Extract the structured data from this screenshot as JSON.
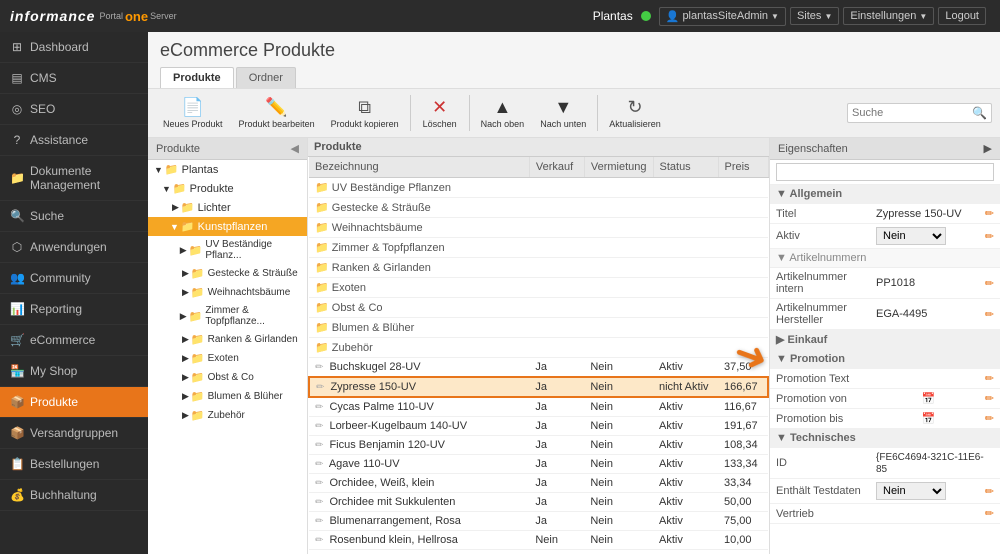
{
  "topbar": {
    "logo": "informance",
    "portal": "Portal",
    "one": "one",
    "server": "Server",
    "site": "Plantas",
    "user": "plantasSiteAdmin",
    "sites_label": "Sites",
    "settings_label": "Einstellungen",
    "logout_label": "Logout"
  },
  "sidebar": {
    "items": [
      {
        "id": "dashboard",
        "label": "Dashboard",
        "icon": "⊞"
      },
      {
        "id": "cms",
        "label": "CMS",
        "icon": "▤"
      },
      {
        "id": "seo",
        "label": "SEO",
        "icon": "◎"
      },
      {
        "id": "assistance",
        "label": "Assistance",
        "icon": "?"
      },
      {
        "id": "dokumente",
        "label": "Dokumente Management",
        "icon": "📁"
      },
      {
        "id": "suche",
        "label": "Suche",
        "icon": "🔍"
      },
      {
        "id": "anwendungen",
        "label": "Anwendungen",
        "icon": "⬡"
      },
      {
        "id": "community",
        "label": "Community",
        "icon": "👥"
      },
      {
        "id": "reporting",
        "label": "Reporting",
        "icon": "📊"
      },
      {
        "id": "ecommerce",
        "label": "eCommerce",
        "icon": "🛒"
      },
      {
        "id": "myshop",
        "label": "My Shop",
        "icon": "🏪"
      },
      {
        "id": "produkte",
        "label": "Produkte",
        "icon": "📦",
        "active": true
      },
      {
        "id": "versandgruppen",
        "label": "Versandgruppen",
        "icon": "📦"
      },
      {
        "id": "bestellungen",
        "label": "Bestellungen",
        "icon": "📋"
      },
      {
        "id": "buchhaltung",
        "label": "Buchhaltung",
        "icon": "💰"
      }
    ]
  },
  "content": {
    "title": "eCommerce Produkte",
    "tabs": [
      "Produkte",
      "Ordner"
    ],
    "active_tab": "Produkte"
  },
  "toolbar": {
    "buttons": [
      {
        "id": "new",
        "label": "Neues Produkt",
        "icon": "📄"
      },
      {
        "id": "edit",
        "label": "Produkt bearbeiten",
        "icon": "✏️"
      },
      {
        "id": "copy",
        "label": "Produkt kopieren",
        "icon": "⧉"
      },
      {
        "id": "delete",
        "label": "Löschen",
        "icon": "✕"
      },
      {
        "id": "up",
        "label": "Nach oben",
        "icon": "▲"
      },
      {
        "id": "down",
        "label": "Nach unten",
        "icon": "▼"
      },
      {
        "id": "refresh",
        "label": "Aktualisieren",
        "icon": "↻"
      }
    ],
    "search_placeholder": "Suche"
  },
  "tree": {
    "header": "Produkte",
    "items": [
      {
        "id": "plantas",
        "label": "Plantas",
        "level": 0,
        "type": "root",
        "expanded": true
      },
      {
        "id": "produkte-root",
        "label": "Produkte",
        "level": 1,
        "type": "folder",
        "expanded": true
      },
      {
        "id": "lichter",
        "label": "Lichter",
        "level": 2,
        "type": "folder"
      },
      {
        "id": "kunstpflanzen",
        "label": "Kunstpflanzen",
        "level": 2,
        "type": "folder",
        "selected": true
      },
      {
        "id": "uv-bestandige",
        "label": "UV Beständige Pflanz...",
        "level": 3,
        "type": "folder"
      },
      {
        "id": "gestecke",
        "label": "Gestecke & Sträuße",
        "level": 3,
        "type": "folder"
      },
      {
        "id": "weihnachts",
        "label": "Weihnachtsbäume",
        "level": 3,
        "type": "folder"
      },
      {
        "id": "zimmer",
        "label": "Zimmer & Topfpflanze...",
        "level": 3,
        "type": "folder"
      },
      {
        "id": "ranken",
        "label": "Ranken & Girlanden",
        "level": 3,
        "type": "folder"
      },
      {
        "id": "exoten",
        "label": "Exoten",
        "level": 3,
        "type": "folder"
      },
      {
        "id": "obst",
        "label": "Obst & Co",
        "level": 3,
        "type": "folder"
      },
      {
        "id": "blumen",
        "label": "Blumen & Blüher",
        "level": 3,
        "type": "folder"
      },
      {
        "id": "zubehor",
        "label": "Zubehör",
        "level": 3,
        "type": "folder"
      }
    ]
  },
  "products_table": {
    "header": "Produkte",
    "columns": [
      "Bezeichnung",
      "Verkauf",
      "Vermietung",
      "Status",
      "Preis"
    ],
    "folders": [
      "UV Beständige Pflanzen",
      "Gestecke & Sträuße",
      "Weihnachtsbäume",
      "Zimmer & Topfpflanzen",
      "Ranken & Girlanden",
      "Exoten",
      "Obst & Co",
      "Blumen & Blüher",
      "Zubehör"
    ],
    "rows": [
      {
        "name": "Buchskugel 28-UV",
        "verkauf": "Ja",
        "vermietung": "Nein",
        "status": "Aktiv",
        "preis": "37,50",
        "selected": false
      },
      {
        "name": "Zypresse 150-UV",
        "verkauf": "Ja",
        "vermietung": "Nein",
        "status": "nicht Aktiv",
        "preis": "166,67",
        "selected": true
      },
      {
        "name": "Cycas Palme 110-UV",
        "verkauf": "Ja",
        "vermietung": "Nein",
        "status": "Aktiv",
        "preis": "116,67",
        "selected": false
      },
      {
        "name": "Lorbeer-Kugelbaum 140-UV",
        "verkauf": "Ja",
        "vermietung": "Nein",
        "status": "Aktiv",
        "preis": "191,67",
        "selected": false
      },
      {
        "name": "Ficus Benjamin 120-UV",
        "verkauf": "Ja",
        "vermietung": "Nein",
        "status": "Aktiv",
        "preis": "108,34",
        "selected": false
      },
      {
        "name": "Agave 110-UV",
        "verkauf": "Ja",
        "vermietung": "Nein",
        "status": "Aktiv",
        "preis": "133,34",
        "selected": false
      },
      {
        "name": "Orchidee, Weiß, klein",
        "verkauf": "Ja",
        "vermietung": "Nein",
        "status": "Aktiv",
        "preis": "33,34",
        "selected": false
      },
      {
        "name": "Orchidee mit Sukkulenten",
        "verkauf": "Ja",
        "vermietung": "Nein",
        "status": "Aktiv",
        "preis": "50,00",
        "selected": false
      },
      {
        "name": "Blumenarrangement, Rosa",
        "verkauf": "Ja",
        "vermietung": "Nein",
        "status": "Aktiv",
        "preis": "75,00",
        "selected": false
      },
      {
        "name": "Rosenbund klein, Hellrosa",
        "verkauf": "Nein",
        "vermietung": "Nein",
        "status": "Aktiv",
        "preis": "10,00",
        "selected": false
      }
    ]
  },
  "properties": {
    "header": "Eigenschaften",
    "sections": [
      {
        "name": "Allgemein",
        "props": [
          {
            "key": "Titel",
            "value": "Zypresse 150-UV",
            "editable": true
          },
          {
            "key": "Aktiv",
            "value": "Nein",
            "type": "select",
            "editable": true
          },
          {
            "key": "Artikelnummern",
            "value": "",
            "editable": false,
            "subsection": true
          },
          {
            "key": "Artikelnummer intern",
            "value": "PP1018",
            "editable": true
          },
          {
            "key": "Artikelnummer Hersteller",
            "value": "EGA-4495",
            "editable": true
          }
        ]
      },
      {
        "name": "Einkauf",
        "props": []
      },
      {
        "name": "Promotion",
        "props": [
          {
            "key": "Promotion Text",
            "value": "",
            "editable": true
          },
          {
            "key": "Promotion von",
            "value": "",
            "type": "date",
            "editable": true
          },
          {
            "key": "Promotion bis",
            "value": "",
            "type": "date",
            "editable": true
          }
        ]
      },
      {
        "name": "Technisches",
        "props": [
          {
            "key": "ID",
            "value": "{FE6C4694-321C-11E6-85",
            "editable": false
          },
          {
            "key": "Enthält Testdaten",
            "value": "Nein",
            "type": "select",
            "editable": true
          },
          {
            "key": "Vertrieb",
            "value": "",
            "editable": false
          }
        ]
      }
    ]
  }
}
